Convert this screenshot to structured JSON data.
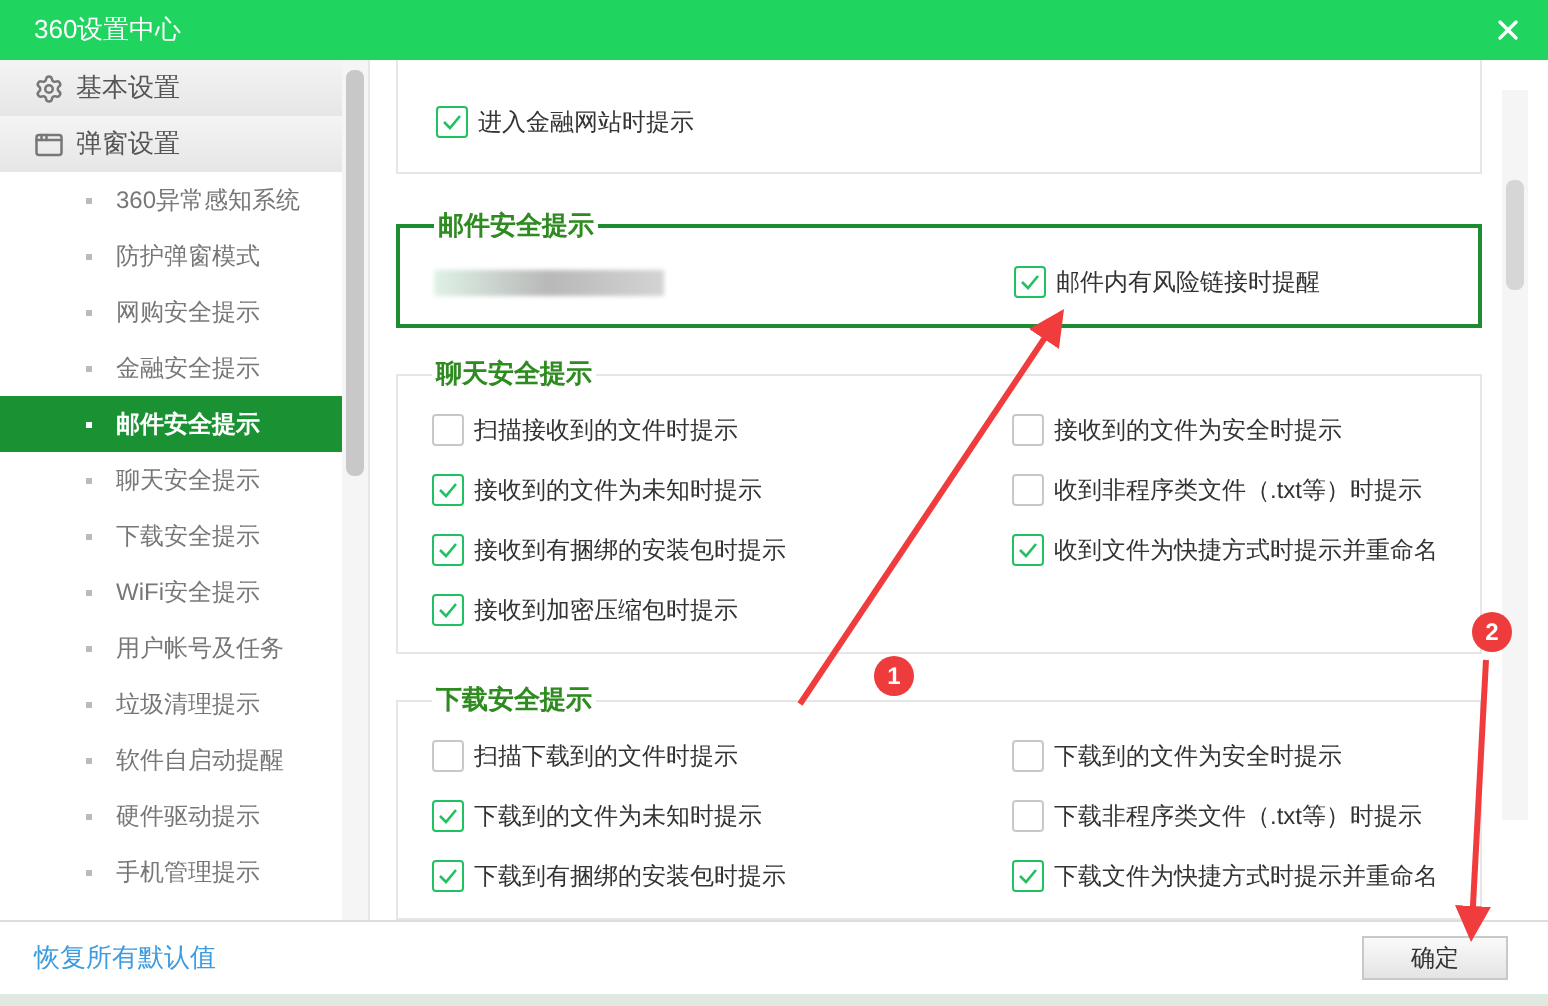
{
  "window": {
    "title": "360设置中心"
  },
  "sidebar": {
    "groups": [
      {
        "label": "基本设置",
        "kind": "gear"
      },
      {
        "label": "弹窗设置",
        "kind": "window",
        "children": [
          {
            "label": "360异常感知系统",
            "selected": false
          },
          {
            "label": "防护弹窗模式",
            "selected": false
          },
          {
            "label": "网购安全提示",
            "selected": false
          },
          {
            "label": "金融安全提示",
            "selected": false
          },
          {
            "label": "邮件安全提示",
            "selected": true
          },
          {
            "label": "聊天安全提示",
            "selected": false
          },
          {
            "label": "下载安全提示",
            "selected": false
          },
          {
            "label": "WiFi安全提示",
            "selected": false
          },
          {
            "label": "用户帐号及任务",
            "selected": false
          },
          {
            "label": "垃圾清理提示",
            "selected": false
          },
          {
            "label": "软件自启动提醒",
            "selected": false
          },
          {
            "label": "硬件驱动提示",
            "selected": false
          },
          {
            "label": "手机管理提示",
            "selected": false
          }
        ]
      }
    ]
  },
  "sections": [
    {
      "highlighted": false,
      "options": [
        {
          "kind": "checkbox",
          "label": "进入金融网站时提示",
          "checked": true
        }
      ]
    },
    {
      "title": "邮件安全提示",
      "highlighted": true,
      "options": [
        {
          "kind": "redacted"
        },
        {
          "kind": "checkbox",
          "label": "邮件内有风险链接时提醒",
          "checked": true
        }
      ]
    },
    {
      "title": "聊天安全提示",
      "highlighted": false,
      "options": [
        {
          "kind": "checkbox",
          "label": "扫描接收到的文件时提示",
          "checked": false
        },
        {
          "kind": "checkbox",
          "label": "接收到的文件为安全时提示",
          "checked": false
        },
        {
          "kind": "checkbox",
          "label": "接收到的文件为未知时提示",
          "checked": true
        },
        {
          "kind": "checkbox",
          "label": "收到非程序类文件（.txt等）时提示",
          "checked": false
        },
        {
          "kind": "checkbox",
          "label": "接收到有捆绑的安装包时提示",
          "checked": true
        },
        {
          "kind": "checkbox",
          "label": "收到文件为快捷方式时提示并重命名",
          "checked": true
        },
        {
          "kind": "checkbox",
          "label": "接收到加密压缩包时提示",
          "checked": true
        }
      ]
    },
    {
      "title": "下载安全提示",
      "highlighted": false,
      "options": [
        {
          "kind": "checkbox",
          "label": "扫描下载到的文件时提示",
          "checked": false
        },
        {
          "kind": "checkbox",
          "label": "下载到的文件为安全时提示",
          "checked": false
        },
        {
          "kind": "checkbox",
          "label": "下载到的文件为未知时提示",
          "checked": true
        },
        {
          "kind": "checkbox",
          "label": "下载非程序类文件（.txt等）时提示",
          "checked": false
        },
        {
          "kind": "checkbox",
          "label": "下载到有捆绑的安装包时提示",
          "checked": true
        },
        {
          "kind": "checkbox",
          "label": "下载文件为快捷方式时提示并重命名",
          "checked": true
        }
      ]
    }
  ],
  "footer": {
    "reset_link": "恢复所有默认值",
    "ok_button": "确定"
  },
  "annotations": [
    {
      "label": "1"
    },
    {
      "label": "2"
    }
  ]
}
